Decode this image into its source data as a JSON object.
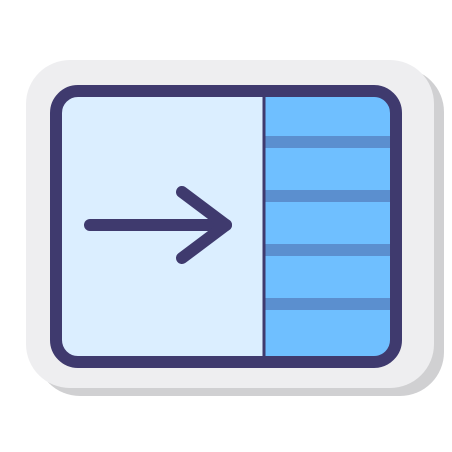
{
  "icon": {
    "name": "sidebar-right-panel-icon",
    "style": "sticker",
    "colors": {
      "sticker_shadow": "#d0d0d2",
      "sticker_border": "#eeeef0",
      "frame_outline": "#3f3a6e",
      "left_panel": "#dbeeff",
      "right_panel": "#6fbfff",
      "right_panel_lines": "#5b8fcf",
      "arrow": "#3f3a6e"
    },
    "right_panel_line_count": 4
  }
}
